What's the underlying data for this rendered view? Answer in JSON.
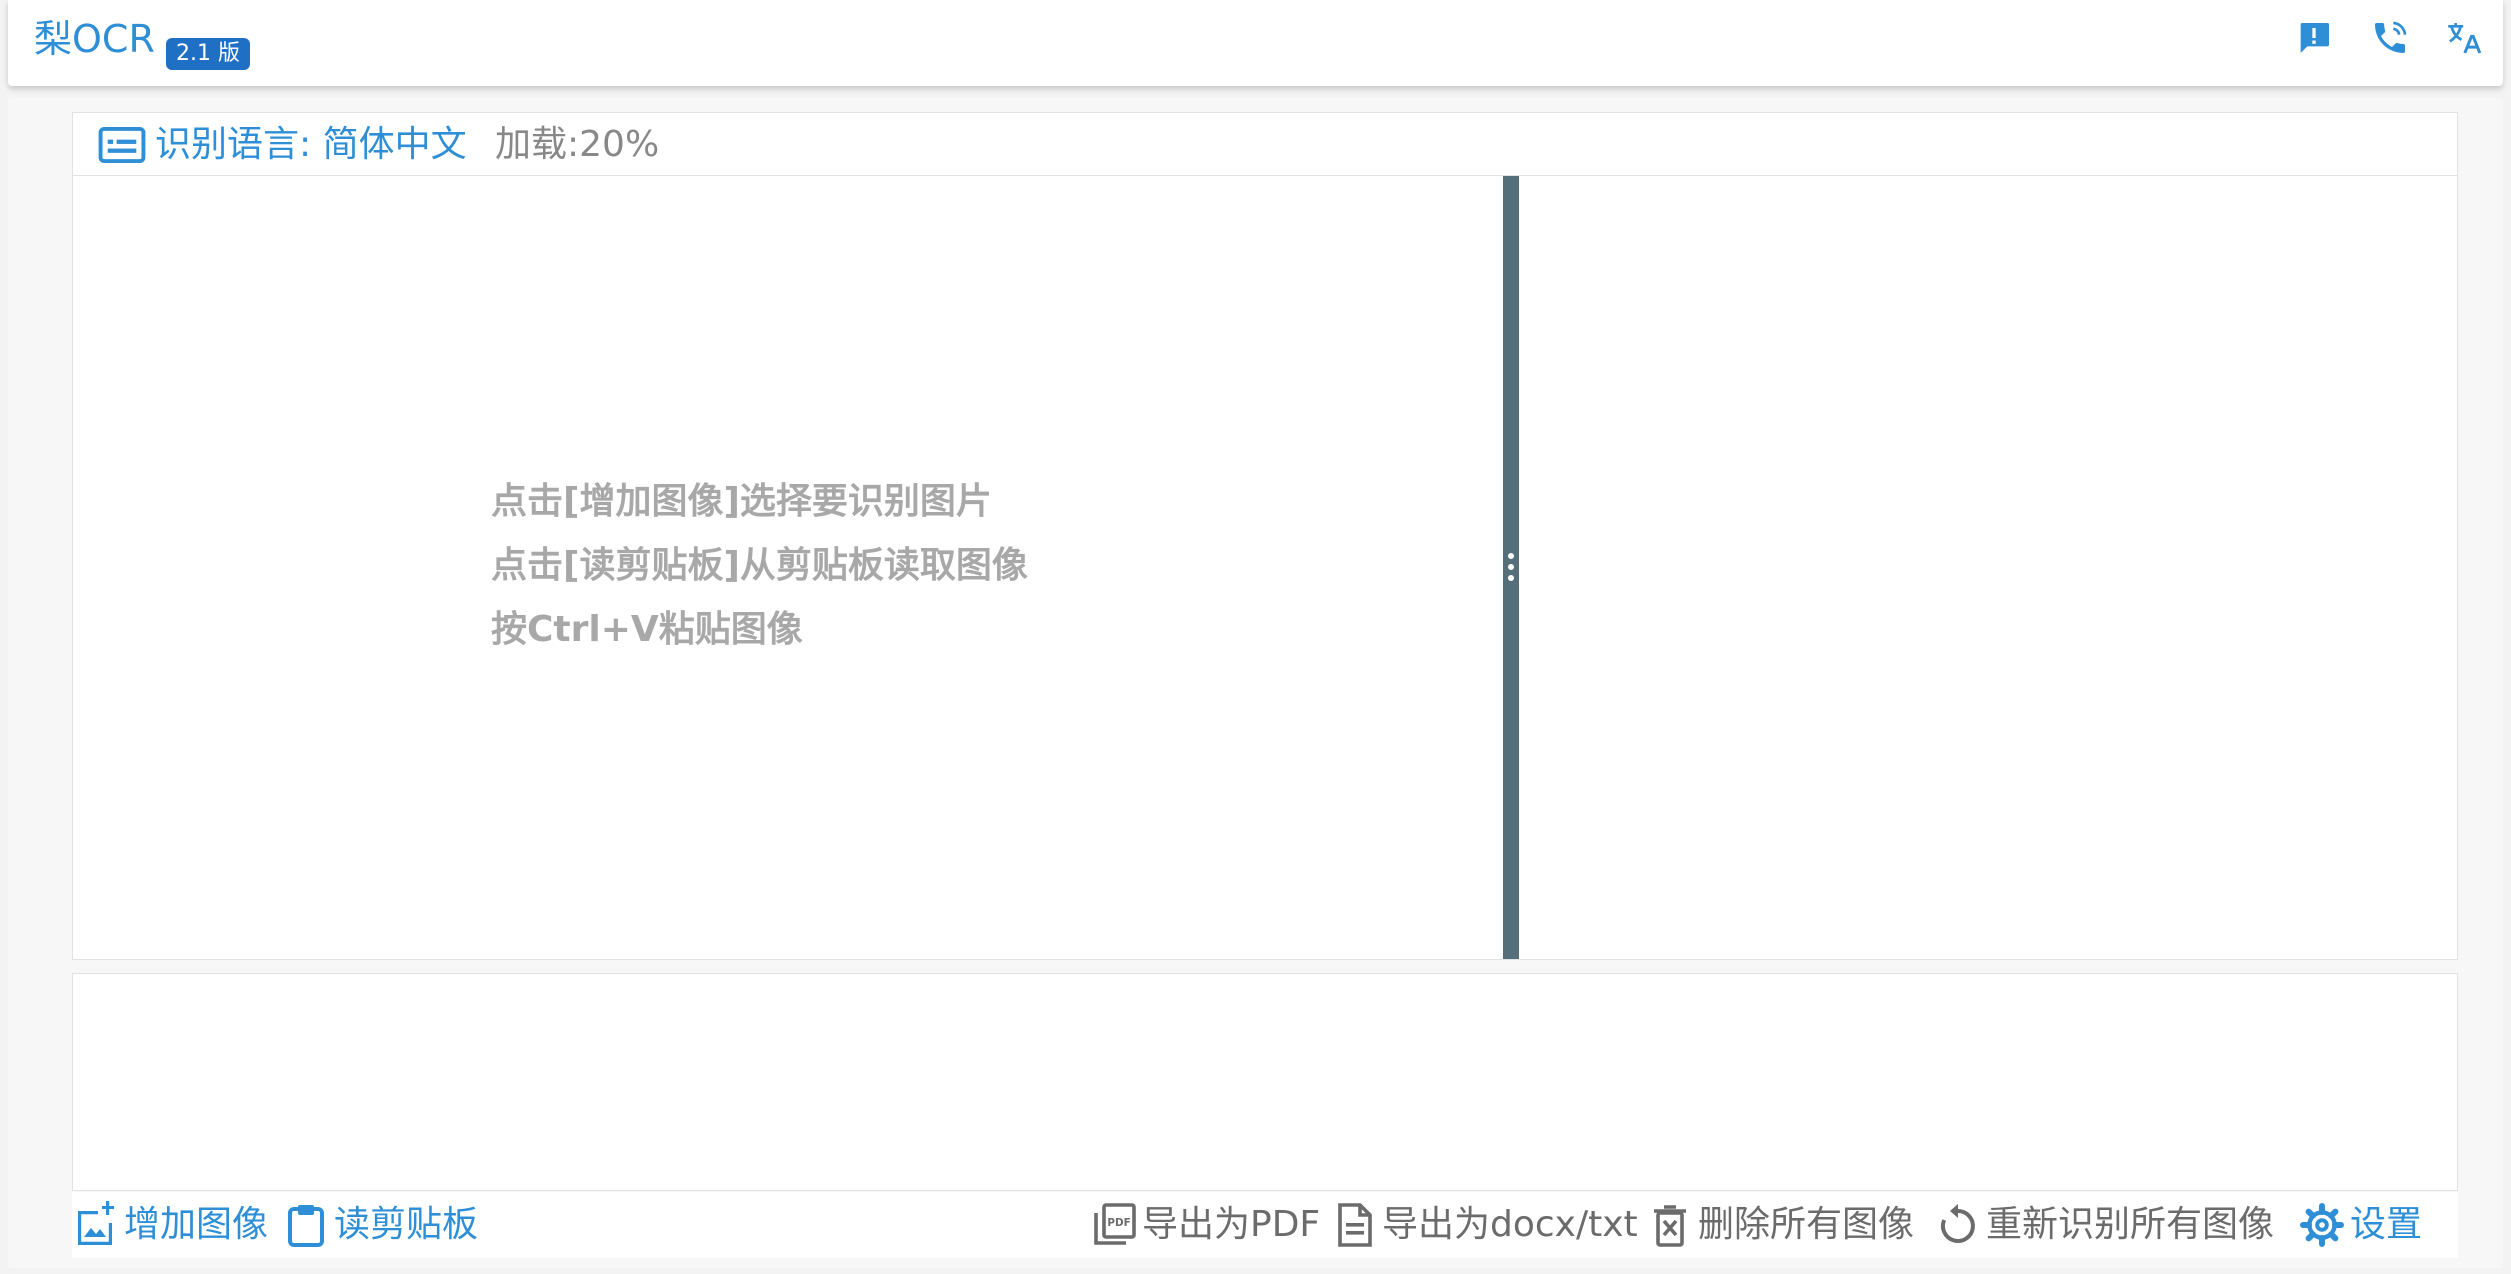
{
  "app": {
    "title": "梨OCR",
    "version_badge": "2.1 版"
  },
  "header_icons": [
    "feedback-icon",
    "phone-icon",
    "translate-icon"
  ],
  "lang_bar": {
    "icon": "subtitles-icon",
    "language_label": "识别语言: 简体中文",
    "load_status": "加载:20%",
    "load_progress_percent": 20
  },
  "workspace": {
    "hints": [
      "点击[增加图像]选择要识别图片",
      "点击[读剪贴板]从剪贴板读取图像",
      "按Ctrl+V粘贴图像"
    ],
    "splitter_icon": "drag-handle-icon"
  },
  "toolbar": {
    "add_image": "增加图像",
    "read_clipboard": "读剪贴板",
    "export_pdf": "导出为PDF",
    "export_docx": "导出为docx/txt",
    "delete_all": "删除所有图像",
    "rerecognize_all": "重新识别所有图像",
    "settings": "设置"
  },
  "colors": {
    "accent": "#2e8fd6",
    "badge": "#1f6fc4",
    "splitter": "#546e7a",
    "muted_text": "#6b6b6b",
    "hint_text": "#a8a8a8"
  }
}
